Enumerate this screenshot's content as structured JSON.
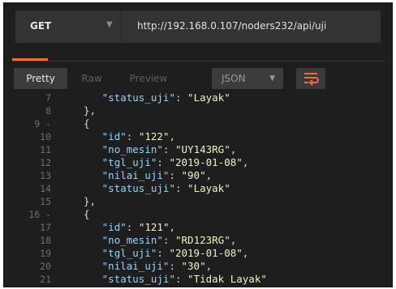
{
  "request": {
    "method": "GET",
    "url": "http://192.168.0.107/noders232/api/uji"
  },
  "toolbar": {
    "pretty": "Pretty",
    "raw": "Raw",
    "preview": "Preview",
    "format": "JSON",
    "wrap_icon": "wrap-lines-icon"
  },
  "colors": {
    "accent": "#f26b3a",
    "key": "#9bd3f0",
    "string": "#f0f0c8",
    "background": "#1e1e1e"
  },
  "lines": [
    {
      "n": "7",
      "indent": 6,
      "type": "kv",
      "key": "status_uji",
      "value": "Layak",
      "comma": false,
      "partial": true
    },
    {
      "n": "8",
      "indent": 3,
      "type": "text",
      "text": "},"
    },
    {
      "n": "9 -",
      "indent": 3,
      "type": "text",
      "text": "{"
    },
    {
      "n": "10",
      "indent": 6,
      "type": "kv",
      "key": "id",
      "value": "122",
      "comma": true
    },
    {
      "n": "11",
      "indent": 6,
      "type": "kv",
      "key": "no_mesin",
      "value": "UY143RG",
      "comma": true
    },
    {
      "n": "12",
      "indent": 6,
      "type": "kv",
      "key": "tgl_uji",
      "value": "2019-01-08",
      "comma": true
    },
    {
      "n": "13",
      "indent": 6,
      "type": "kv",
      "key": "nilai_uji",
      "value": "90",
      "comma": true
    },
    {
      "n": "14",
      "indent": 6,
      "type": "kv",
      "key": "status_uji",
      "value": "Layak",
      "comma": false
    },
    {
      "n": "15",
      "indent": 3,
      "type": "text",
      "text": "},"
    },
    {
      "n": "16 -",
      "indent": 3,
      "type": "text",
      "text": "{"
    },
    {
      "n": "17",
      "indent": 6,
      "type": "kv",
      "key": "id",
      "value": "121",
      "comma": true
    },
    {
      "n": "18",
      "indent": 6,
      "type": "kv",
      "key": "no_mesin",
      "value": "RD123RG",
      "comma": true
    },
    {
      "n": "19",
      "indent": 6,
      "type": "kv",
      "key": "tgl_uji",
      "value": "2019-01-08",
      "comma": true
    },
    {
      "n": "20",
      "indent": 6,
      "type": "kv",
      "key": "nilai_uji",
      "value": "30",
      "comma": true
    },
    {
      "n": "21",
      "indent": 6,
      "type": "kv",
      "key": "status_uji",
      "value": "Tidak Layak",
      "comma": false
    }
  ]
}
